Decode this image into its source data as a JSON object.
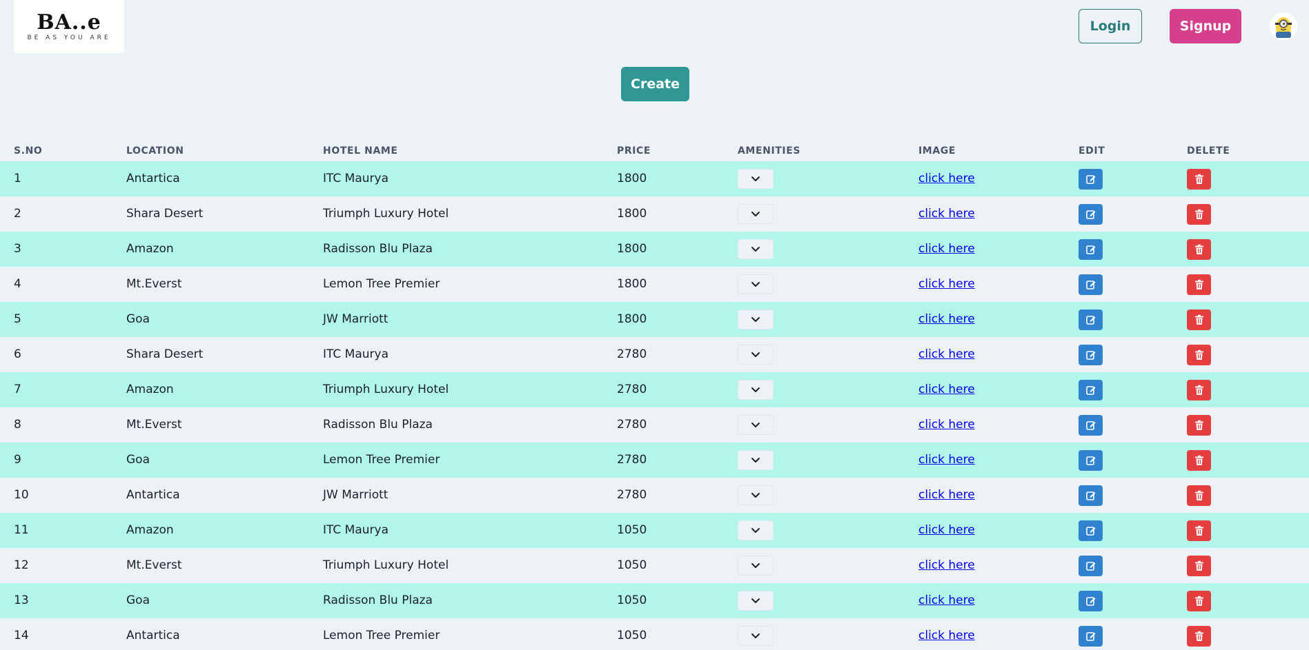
{
  "header": {
    "logo_mark": "BA..e",
    "logo_tagline": "BE AS YOU ARE",
    "login_label": "Login",
    "signup_label": "Signup"
  },
  "actions": {
    "create_label": "Create"
  },
  "colors": {
    "accent_teal": "#319795",
    "signup_pink": "#d53f8c",
    "row_highlight": "#b2f5ea",
    "edit_blue": "#3182ce",
    "delete_red": "#e53e3e"
  },
  "icons": {
    "amenities": "chevron-down-icon",
    "edit": "edit-icon",
    "delete": "trash-icon",
    "avatar": "minion-avatar"
  },
  "table": {
    "columns": [
      "S.NO",
      "LOCATION",
      "HOTEL NAME",
      "PRICE",
      "AMENITIES",
      "IMAGE",
      "EDIT",
      "DELETE"
    ],
    "link_text": "click here",
    "rows": [
      {
        "sno": "1",
        "location": "Antartica",
        "hotel": "ITC Maurya",
        "price": "1800"
      },
      {
        "sno": "2",
        "location": "Shara Desert",
        "hotel": "Triumph Luxury Hotel",
        "price": "1800"
      },
      {
        "sno": "3",
        "location": "Amazon",
        "hotel": "Radisson Blu Plaza",
        "price": "1800"
      },
      {
        "sno": "4",
        "location": "Mt.Everst",
        "hotel": "Lemon Tree Premier",
        "price": "1800"
      },
      {
        "sno": "5",
        "location": "Goa",
        "hotel": "JW Marriott",
        "price": "1800"
      },
      {
        "sno": "6",
        "location": "Shara Desert",
        "hotel": "ITC Maurya",
        "price": "2780"
      },
      {
        "sno": "7",
        "location": "Amazon",
        "hotel": "Triumph Luxury Hotel",
        "price": "2780"
      },
      {
        "sno": "8",
        "location": "Mt.Everst",
        "hotel": "Radisson Blu Plaza",
        "price": "2780"
      },
      {
        "sno": "9",
        "location": "Goa",
        "hotel": "Lemon Tree Premier",
        "price": "2780"
      },
      {
        "sno": "10",
        "location": "Antartica",
        "hotel": "JW Marriott",
        "price": "2780"
      },
      {
        "sno": "11",
        "location": "Amazon",
        "hotel": "ITC Maurya",
        "price": "1050"
      },
      {
        "sno": "12",
        "location": "Mt.Everst",
        "hotel": "Triumph Luxury Hotel",
        "price": "1050"
      },
      {
        "sno": "13",
        "location": "Goa",
        "hotel": "Radisson Blu Plaza",
        "price": "1050"
      },
      {
        "sno": "14",
        "location": "Antartica",
        "hotel": "Lemon Tree Premier",
        "price": "1050"
      }
    ]
  }
}
